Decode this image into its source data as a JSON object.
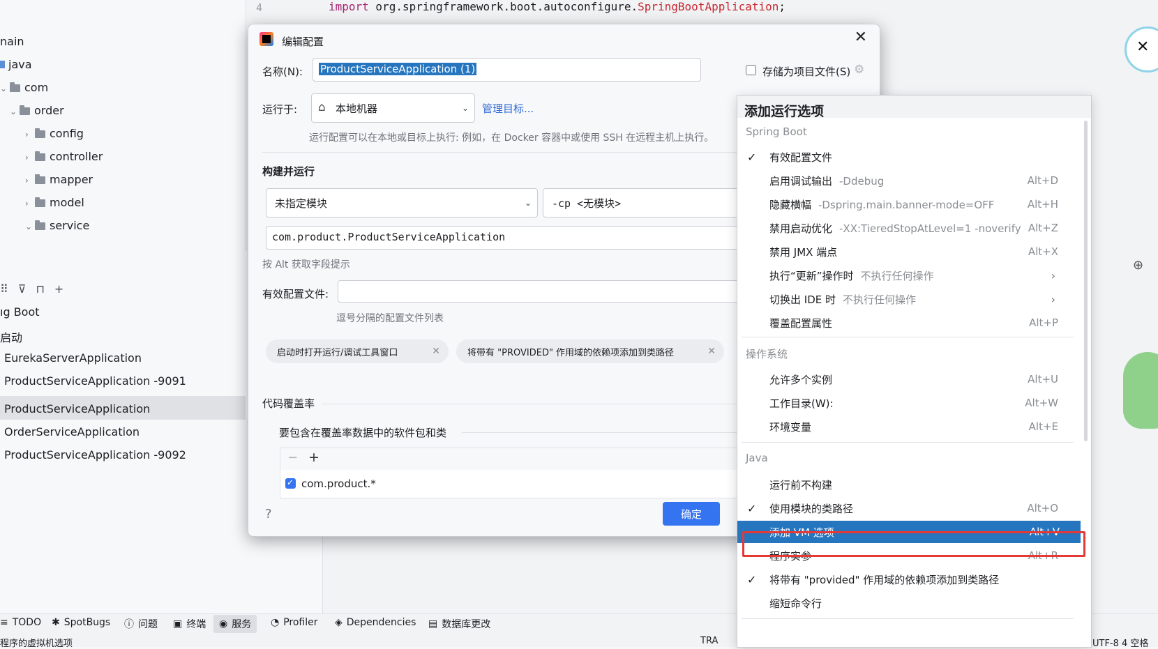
{
  "editor": {
    "line_number": "4",
    "code_kw": "import",
    "code_pkg": " org.springframework.boot.autoconfigure.",
    "code_cls": "SpringBootApplication",
    "code_end": ";"
  },
  "project_tree": [
    "nain",
    "java",
    "com",
    "order",
    "config",
    "controller",
    "mapper",
    "model",
    "service"
  ],
  "services": {
    "items": [
      "ıg Boot",
      "启动",
      "EurekaServerApplication",
      "ProductServiceApplication -9091",
      "ProductServiceApplication",
      "OrderServiceApplication",
      "ProductServiceApplication -9092"
    ]
  },
  "bottom_bar": {
    "items": [
      "TODO",
      "SpotBugs",
      "问题",
      "终端",
      "服务",
      "Profiler",
      "Dependencies",
      "数据库更改"
    ],
    "status_left": "程序的虚拟机选项",
    "status_right": "UTF-8   4 空格",
    "status_tra": "TRA"
  },
  "dialog": {
    "title": "编辑配置",
    "name_label": "名称(N):",
    "name_value": "ProductServiceApplication (1)",
    "store_as_project_file": "存储为项目文件(S)",
    "run_on_label": "运行于:",
    "run_on_value": "本地机器",
    "manage_targets": "管理目标...",
    "run_on_hint": "运行配置可以在本地或目标上执行: 例如，在 Docker 容器中或使用 SSH 在远程主机上执行。",
    "build_run_title": "构建并运行",
    "module_value": "未指定模块",
    "cp_value": "-cp <无模块>",
    "main_class": "com.product.ProductServiceApplication",
    "alt_hint": "按 Alt 获取字段提示",
    "active_profiles_label": "有效配置文件:",
    "active_profiles_hint": "逗号分隔的配置文件列表",
    "chip1": "启动时打开运行/调试工具窗口",
    "chip2": "将带有 \"PROVIDED\" 作用域的依赖项添加到类路径",
    "coverage_title": "代码覆盖率",
    "coverage_sub": "要包含在覆盖率数据中的软件包和类",
    "coverage_pkg": "com.product.*",
    "help": "?",
    "ok": "确定"
  },
  "popup": {
    "title": "添加运行选项",
    "groups": [
      {
        "name": "Spring Boot",
        "items": [
          {
            "label": "有效配置文件",
            "desc": "",
            "shortcut": "",
            "checked": true
          },
          {
            "label": "启用调试输出",
            "desc": "-Ddebug",
            "shortcut": "Alt+D",
            "checked": false
          },
          {
            "label": "隐藏横幅",
            "desc": "-Dspring.main.banner-mode=OFF",
            "shortcut": "Alt+H",
            "checked": false
          },
          {
            "label": "禁用启动优化",
            "desc": "-XX:TieredStopAtLevel=1 -noverify",
            "shortcut": "Alt+Z",
            "checked": false
          },
          {
            "label": "禁用 JMX 端点",
            "desc": "",
            "shortcut": "Alt+X",
            "checked": false
          },
          {
            "label": "执行“更新”操作时",
            "desc": "不执行任何操作",
            "shortcut": "",
            "submenu": true,
            "checked": false
          },
          {
            "label": "切换出 IDE 时",
            "desc": "不执行任何操作",
            "shortcut": "",
            "submenu": true,
            "checked": false
          },
          {
            "label": "覆盖配置属性",
            "desc": "",
            "shortcut": "Alt+P",
            "checked": false
          }
        ]
      },
      {
        "name": "操作系统",
        "items": [
          {
            "label": "允许多个实例",
            "desc": "",
            "shortcut": "Alt+U",
            "checked": false
          },
          {
            "label": "工作目录(W):",
            "desc": "",
            "shortcut": "Alt+W",
            "checked": false
          },
          {
            "label": "环境变量",
            "desc": "",
            "shortcut": "Alt+E",
            "checked": false
          }
        ]
      },
      {
        "name": "Java",
        "items": [
          {
            "label": "运行前不构建",
            "desc": "",
            "shortcut": "",
            "checked": false
          },
          {
            "label": "使用模块的类路径",
            "desc": "",
            "shortcut": "Alt+O",
            "checked": true
          },
          {
            "label": "添加 VM 选项",
            "desc": "",
            "shortcut": "Alt+V",
            "checked": false,
            "selected": true
          },
          {
            "label": "程序实参",
            "desc": "",
            "shortcut": "Alt+R",
            "checked": false
          },
          {
            "label": "将带有 \"provided\" 作用域的依赖项添加到类路径",
            "desc": "",
            "shortcut": "",
            "checked": true
          },
          {
            "label": "缩短命令行",
            "desc": "",
            "shortcut": "",
            "checked": false
          }
        ]
      }
    ]
  },
  "colors": {
    "accent": "#3574f0",
    "selection": "#2675bf",
    "highlight_box": "#e53935"
  }
}
